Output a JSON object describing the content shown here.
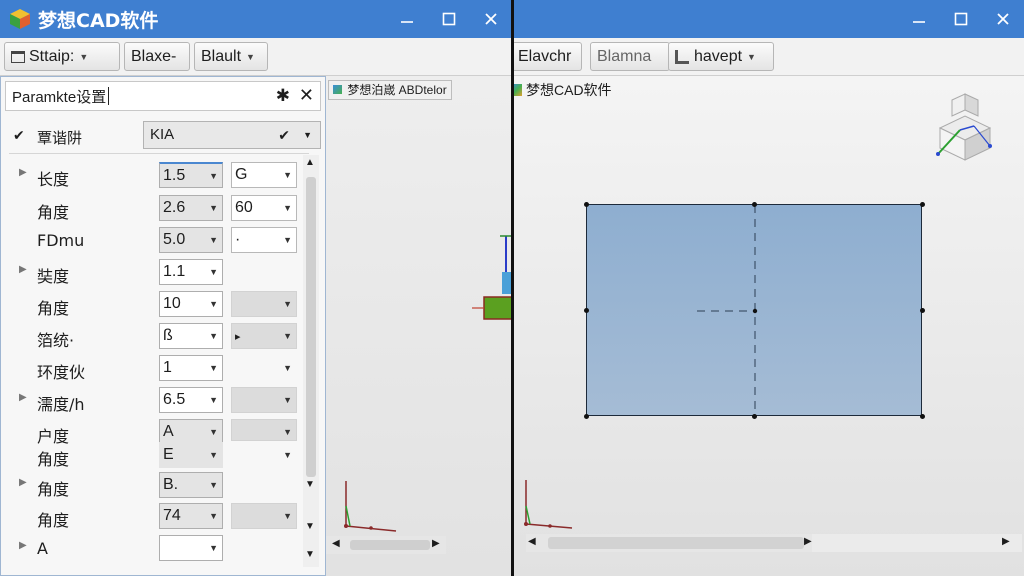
{
  "app": {
    "title": "梦想CAD软件",
    "colors": {
      "titlebar": "#3f7fd0",
      "sketch_fill": "#9ab5d3",
      "panel_border": "#9fb6d2"
    }
  },
  "left_window": {
    "toolbar": {
      "buttons": [
        "Sttaip:",
        "Blaxe-",
        "Blault"
      ]
    },
    "panel": {
      "title": "Paramkte设置",
      "top_row": {
        "label": "覃谐阱",
        "value": "KIA"
      },
      "rows": [
        {
          "label": "长度",
          "v1": "1.5",
          "v2": "G"
        },
        {
          "label": "角度",
          "v1": "2.6",
          "v2": "60"
        },
        {
          "label": "FDmu",
          "v1": "5.0",
          "v2": "·"
        },
        {
          "label": "奘度",
          "v1": "1.1",
          "v2": ""
        },
        {
          "label": "角度",
          "v1": "10",
          "v2": ""
        },
        {
          "label": "箔统·",
          "v1": "ß",
          "v2": "▸"
        },
        {
          "label": "环度伙",
          "v1": "1",
          "v2": ""
        },
        {
          "label": "濡度/h",
          "v1": "6.5",
          "v2": ""
        },
        {
          "label": "户度",
          "v1": "A",
          "v2": ""
        },
        {
          "label": "角度",
          "v1": "E",
          "v2": ""
        },
        {
          "label": "角度",
          "v1": "B.",
          "v2": ""
        },
        {
          "label": "角度",
          "v1": "74",
          "v2": ""
        },
        {
          "label": "A",
          "v1": "",
          "v2": ""
        }
      ]
    },
    "viewport_tab": "梦想泊嵅 ABDtelor"
  },
  "right_window": {
    "toolbar": {
      "buttons": [
        "Elavchr",
        "Blamna",
        "havept"
      ]
    },
    "viewport_label": "梦想CAD软件"
  }
}
